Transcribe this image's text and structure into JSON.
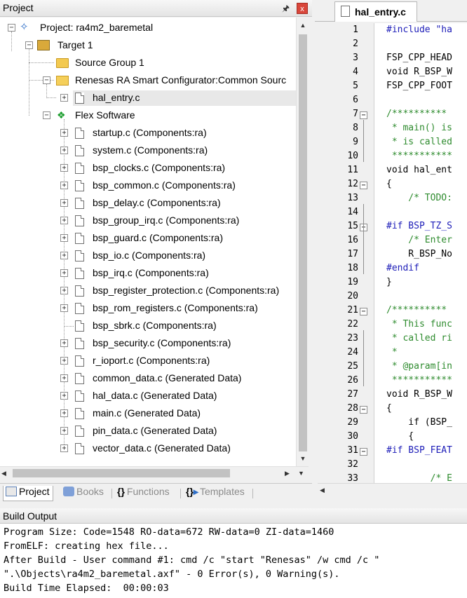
{
  "project_panel": {
    "title": "Project",
    "pin_symbol": "ᵖ",
    "close_symbol": "x",
    "tree": {
      "project": "Project: ra4m2_baremetal",
      "target": "Target 1",
      "source_group": "Source Group 1",
      "renesas_group": "Renesas RA Smart Configurator:Common Sourc",
      "hal_entry": "hal_entry.c",
      "flex_software": "Flex Software",
      "files": [
        "startup.c (Components:ra)",
        "system.c (Components:ra)",
        "bsp_clocks.c (Components:ra)",
        "bsp_common.c (Components:ra)",
        "bsp_delay.c (Components:ra)",
        "bsp_group_irq.c (Components:ra)",
        "bsp_guard.c (Components:ra)",
        "bsp_io.c (Components:ra)",
        "bsp_irq.c (Components:ra)",
        "bsp_register_protection.c (Components:ra)",
        "bsp_rom_registers.c (Components:ra)",
        "bsp_sbrk.c (Components:ra)",
        "bsp_security.c (Components:ra)",
        "r_ioport.c (Components:ra)",
        "common_data.c (Generated Data)",
        "hal_data.c (Generated Data)",
        "main.c (Generated Data)",
        "pin_data.c (Generated Data)",
        "vector_data.c (Generated Data)"
      ]
    },
    "tabs": {
      "project": "Project",
      "books": "Books",
      "functions": "Functions",
      "templates": "Templates"
    }
  },
  "editor": {
    "tab_label": "hal_entry.c",
    "lines": [
      {
        "n": "1",
        "text": "#include \"ha",
        "cls": "c-pre"
      },
      {
        "n": "2",
        "text": "",
        "cls": "c-pl"
      },
      {
        "n": "3",
        "text": "FSP_CPP_HEAD",
        "cls": "c-pl"
      },
      {
        "n": "4",
        "text": "void R_BSP_W",
        "cls": "c-pl"
      },
      {
        "n": "5",
        "text": "FSP_CPP_FOOT",
        "cls": "c-pl"
      },
      {
        "n": "6",
        "text": "",
        "cls": "c-pl"
      },
      {
        "n": "7",
        "text": "/**********",
        "cls": "c-cm"
      },
      {
        "n": "8",
        "text": " * main() is",
        "cls": "c-cm"
      },
      {
        "n": "9",
        "text": " * is called",
        "cls": "c-cm"
      },
      {
        "n": "10",
        "text": " ***********",
        "cls": "c-cm"
      },
      {
        "n": "11",
        "text": "void hal_ent",
        "cls": "c-pl"
      },
      {
        "n": "12",
        "text": "{",
        "cls": "c-pl"
      },
      {
        "n": "13",
        "text": "    /* TODO:",
        "cls": "c-cm"
      },
      {
        "n": "14",
        "text": "",
        "cls": "c-pl"
      },
      {
        "n": "15",
        "text": "#if BSP_TZ_S",
        "cls": "c-pre"
      },
      {
        "n": "16",
        "text": "    /* Enter",
        "cls": "c-cm"
      },
      {
        "n": "17",
        "text": "    R_BSP_No",
        "cls": "c-pl"
      },
      {
        "n": "18",
        "text": "#endif",
        "cls": "c-pre"
      },
      {
        "n": "19",
        "text": "}",
        "cls": "c-pl"
      },
      {
        "n": "20",
        "text": "",
        "cls": "c-pl"
      },
      {
        "n": "21",
        "text": "/**********",
        "cls": "c-cm"
      },
      {
        "n": "22",
        "text": " * This func",
        "cls": "c-cm"
      },
      {
        "n": "23",
        "text": " * called ri",
        "cls": "c-cm"
      },
      {
        "n": "24",
        "text": " *",
        "cls": "c-cm"
      },
      {
        "n": "25",
        "text": " * @param[in",
        "cls": "c-cm"
      },
      {
        "n": "26",
        "text": " ***********",
        "cls": "c-cm"
      },
      {
        "n": "27",
        "text": "void R_BSP_W",
        "cls": "c-pl"
      },
      {
        "n": "28",
        "text": "{",
        "cls": "c-pl"
      },
      {
        "n": "29",
        "text": "    if (BSP_",
        "cls": "c-pl"
      },
      {
        "n": "30",
        "text": "    {",
        "cls": "c-pl"
      },
      {
        "n": "31",
        "text": "#if BSP_FEAT",
        "cls": "c-pre"
      },
      {
        "n": "32",
        "text": "",
        "cls": "c-pl"
      },
      {
        "n": "33",
        "text": "        /* E",
        "cls": "c-cm"
      }
    ]
  },
  "build_output": {
    "title": "Build Output",
    "lines": [
      "Program Size: Code=1548 RO-data=672 RW-data=0 ZI-data=1460",
      "FromELF: creating hex file...",
      "After Build - User command #1: cmd /c \"start \"Renesas\" /w cmd /c \"",
      "\".\\Objects\\ra4m2_baremetal.axf\" - 0 Error(s), 0 Warning(s).",
      "Build Time Elapsed:  00:00:03"
    ]
  }
}
